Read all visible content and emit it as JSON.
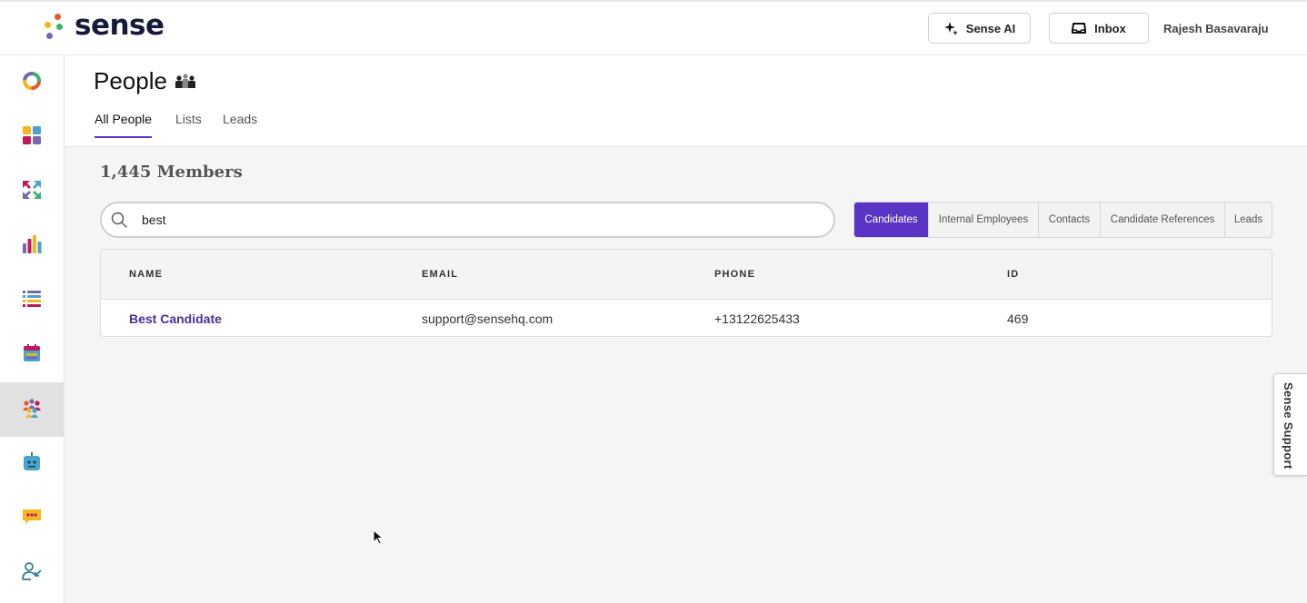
{
  "app": {
    "name": "sense"
  },
  "header": {
    "ai_button": "Sense AI",
    "inbox_button": "Inbox",
    "user_name": "Rajesh Basavaraju"
  },
  "sidebar": {
    "items": [
      {
        "name": "dashboard-ring-icon"
      },
      {
        "name": "apps-grid-icon"
      },
      {
        "name": "workflow-arrows-icon"
      },
      {
        "name": "analytics-bars-icon"
      },
      {
        "name": "list-stack-icon"
      },
      {
        "name": "calendar-icon"
      },
      {
        "name": "people-icon",
        "active": true
      },
      {
        "name": "bot-icon"
      },
      {
        "name": "chat-icon"
      },
      {
        "name": "user-referral-icon"
      }
    ]
  },
  "page": {
    "title": "People",
    "tabs": [
      {
        "label": "All People",
        "active": true
      },
      {
        "label": "Lists"
      },
      {
        "label": "Leads"
      }
    ],
    "members_count": "1,445 Members"
  },
  "search": {
    "value": "best",
    "placeholder": ""
  },
  "filters": [
    {
      "label": "Candidates",
      "active": true
    },
    {
      "label": "Internal Employees"
    },
    {
      "label": "Contacts"
    },
    {
      "label": "Candidate References"
    },
    {
      "label": "Leads"
    }
  ],
  "table": {
    "columns": [
      "NAME",
      "EMAIL",
      "PHONE",
      "ID"
    ],
    "rows": [
      {
        "name": "Best Candidate",
        "email": "support@sensehq.com",
        "phone": "+13122625433",
        "id": "469"
      }
    ]
  },
  "support_tab": "Sense Support",
  "colors": {
    "accent": "#5a34c4",
    "link": "#4b2e9a"
  }
}
